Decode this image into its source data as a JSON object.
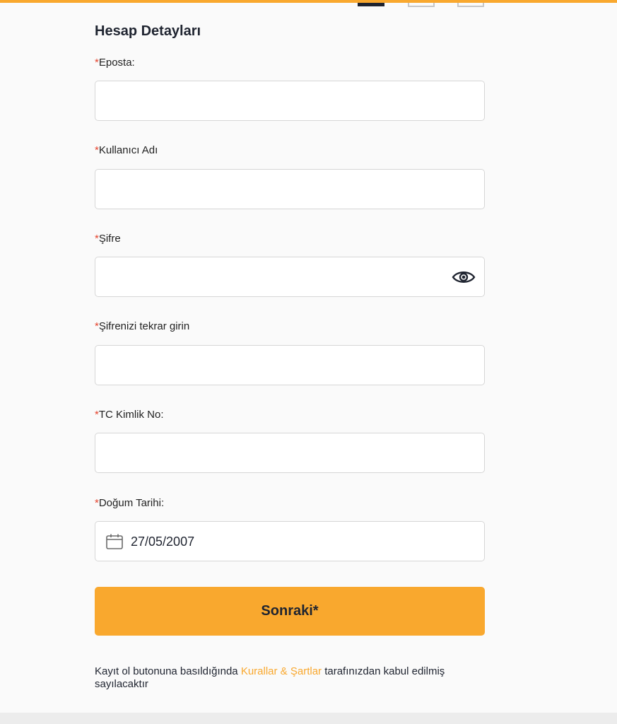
{
  "progress": {
    "current_step": 1,
    "total_steps": 3
  },
  "form": {
    "title": "Hesap Detayları",
    "required_mark": "*",
    "fields": {
      "email": {
        "label": "Eposta:",
        "value": ""
      },
      "username": {
        "label": "Kullanıcı Adı",
        "value": ""
      },
      "password": {
        "label": "Şifre",
        "value": "",
        "icon": "eye-icon"
      },
      "password_confirm": {
        "label": "Şifrenizi tekrar girin",
        "value": ""
      },
      "tc_id": {
        "label": "TC Kimlik No:",
        "value": ""
      },
      "birth_date": {
        "label": "Doğum Tarihi:",
        "value": "27/05/2007",
        "icon": "calendar-icon"
      }
    },
    "next_button": "Sonraki*"
  },
  "terms": {
    "before": "Kayıt ol butonuna basıldığında ",
    "link": "Kurallar & Şartlar",
    "after": " tarafınızdan kabul edilmiş sayılacaktır"
  },
  "colors": {
    "accent": "#f9a82e",
    "required": "#e5432d",
    "text": "#1f2430"
  }
}
